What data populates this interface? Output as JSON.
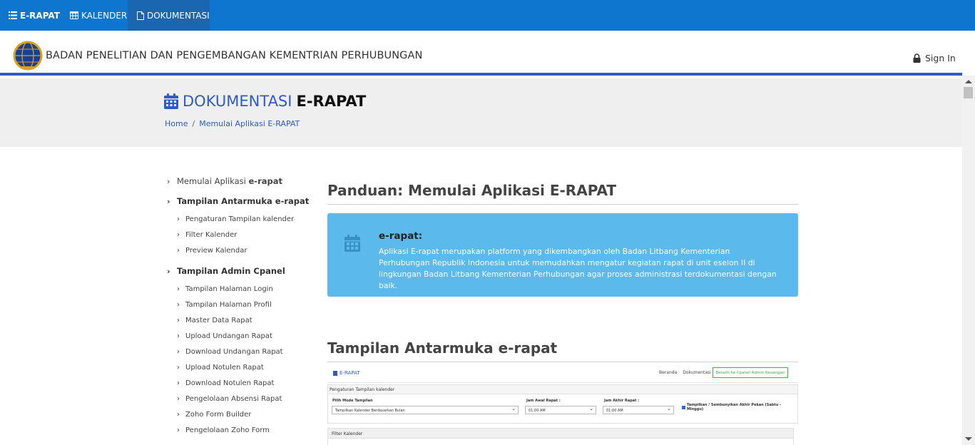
{
  "topnav": {
    "brand": "E-RAPAT",
    "kalender": "KALENDER",
    "dokumentasi": "DOKUMENTASI"
  },
  "header": {
    "org_name": "BADAN PENELITIAN DAN PENGEMBANGAN KEMENTRIAN PERHUBUNGAN",
    "signin": "Sign In"
  },
  "banner": {
    "title_part1": "DOKUMENTASI",
    "title_part2": "E-RAPAT",
    "breadcrumb": [
      "Home",
      "Memulai Aplikasi E-RAPAT"
    ]
  },
  "sidebar": {
    "memulai_prefix": "Memulai Aplikasi ",
    "memulai_suffix": "e-rapat",
    "antarmuka": "Tampilan Antarmuka e-rapat",
    "antarmuka_items": [
      "Pengaturan Tampilan kalender",
      "Filter Kalender",
      "Preview Kalendar"
    ],
    "admin": "Tampilan Admin Cpanel",
    "admin_items": [
      "Tampilan Halaman Login",
      "Tampilan Halaman Profil",
      "Master Data Rapat",
      "Upload Undangan Rapat",
      "Download Undangan Rapat",
      "Upload Notulen Rapat",
      "Download Notulen Rapat",
      "Pengelolaan Absensi Rapat",
      "Zoho Form Builder",
      "Pengelolaan Zoho Form"
    ]
  },
  "main": {
    "heading1": "Panduan: Memulai Aplikasi E-RAPAT",
    "info_title": "e-rapat:",
    "info_text": "Aplikasi E-rapat merupakan platform yang dikembangkan oleh Badan Litbang Kementerian Perhubungan Republik Indonesia untuk memudahkan mengatur kegiatan rapat di unit eselon II di lingkungan Badan Litbang Kementerian Perhubungan agar proses administrasi terdokumentasi dengan baik.",
    "heading2": "Tampilan Antarmuka e-rapat"
  },
  "screenshot": {
    "brand": "E-RAPAT",
    "links": [
      "Beranda",
      "Dokumentasi"
    ],
    "button": "Beralih ke Cpanel Admin Keuangan",
    "panel1_title": "Pengaturan Tampilan kalender",
    "mode_label": "Pilih Mode Tampilan",
    "mode_value": "Tampilkan Kalender Berdasarkan Bulan",
    "jam_awal_label": "Jam Awal Rapat :",
    "jam_awal_value": "01:00 AM",
    "jam_akhir_label": "Jam Akhir Rapat :",
    "jam_akhir_value": "01:00 AM",
    "checkbox_label": "Tampilkan / Sembunyikan Akhir Pekan (Sabtu - Minggu)",
    "panel2_title": "Filter Kalender"
  },
  "colors": {
    "nav_bg": "#0f76d0",
    "accent": "#2f5ac8",
    "info_bg": "#5bb9ec"
  }
}
